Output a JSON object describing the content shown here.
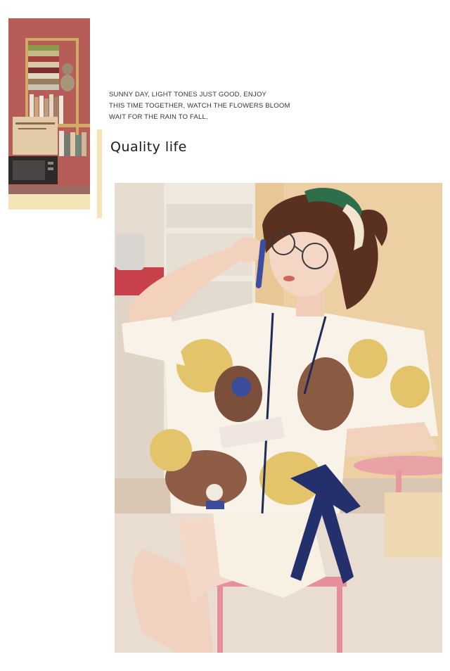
{
  "tagline": {
    "line1": "SUNNY DAY, LIGHT TONES JUST GOOD, ENJOY",
    "line2": "THIS TIME TOGETHER, WATCH THE FLOWERS BLOOM",
    "line3": "WAIT FOR THE RAIN TO FALL."
  },
  "heading": "Quality life",
  "colors": {
    "accent": "#f6e4b9",
    "thumbnail_wall": "#b75d58"
  }
}
